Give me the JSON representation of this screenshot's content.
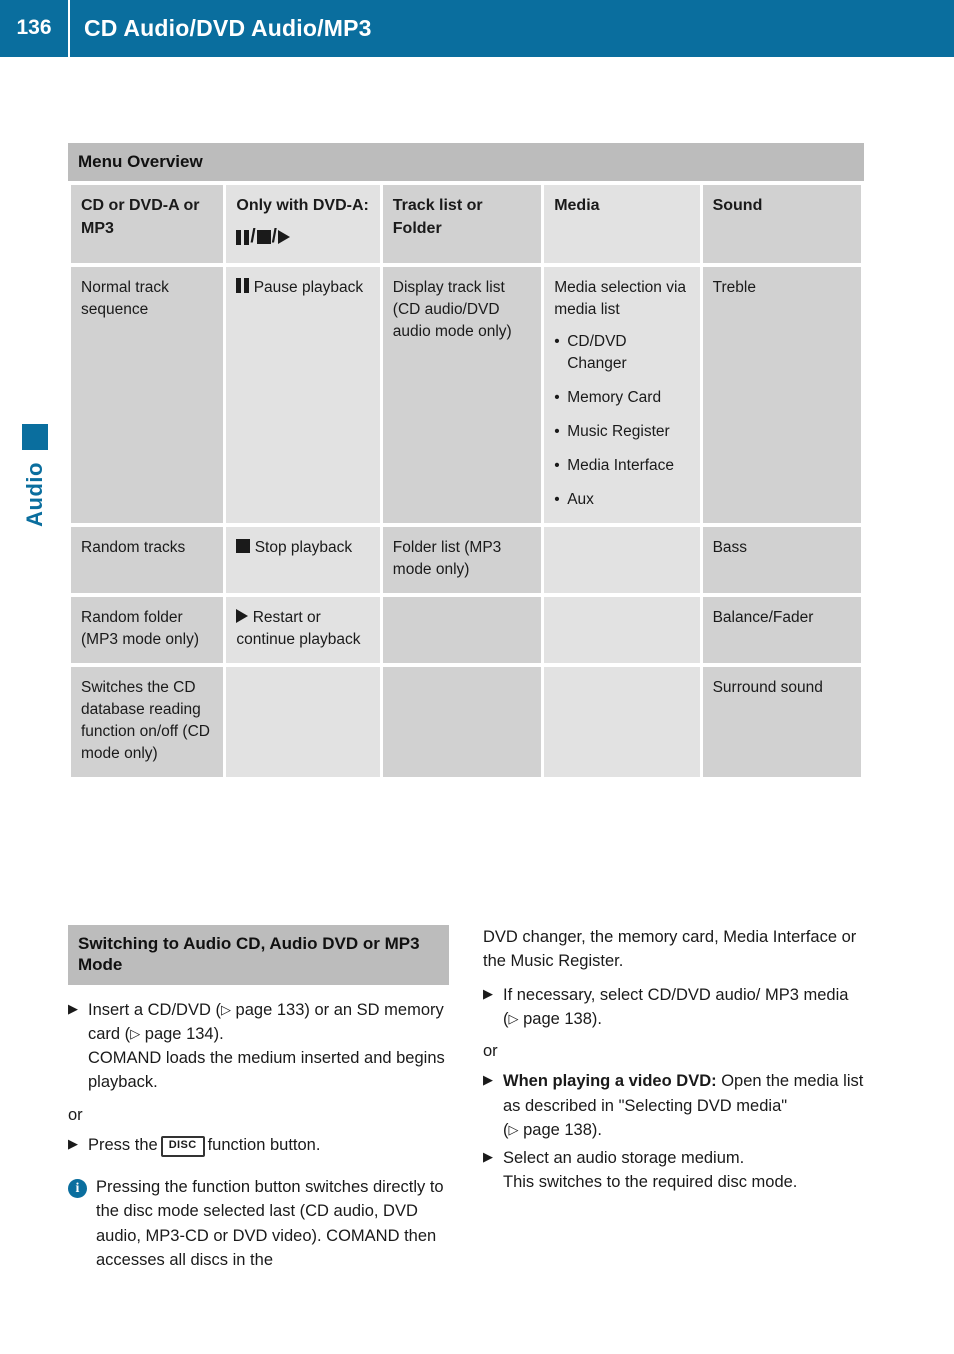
{
  "header": {
    "page_number": "136",
    "title": "CD Audio/DVD Audio/MP3",
    "accent_color": "#0a6e9e"
  },
  "side_tab": {
    "label": "Audio",
    "color": "#0a6e9e"
  },
  "menu_overview": {
    "banner": "Menu Overview",
    "columns": [
      {
        "header": "CD or DVD-A or MP3",
        "shade": "dark"
      },
      {
        "header": "Only with DVD-A:",
        "glyphs": "pause/stop/play",
        "shade": "light"
      },
      {
        "header": "Track list or Folder",
        "shade": "dark"
      },
      {
        "header": "Media",
        "shade": "light"
      },
      {
        "header": "Sound",
        "shade": "dark"
      }
    ],
    "rows": [
      {
        "c1": "Normal track sequence",
        "c2_icon": "pause-icon",
        "c2": "Pause playback",
        "c3": "Display track list (CD audio/DVD audio mode only)",
        "c4": "Media selection via media list",
        "c4_bullets": [
          "CD/DVD Changer",
          "Memory Card",
          "Music Register",
          "Media Interface",
          "Aux"
        ],
        "c5": "Treble"
      },
      {
        "c1": "Random tracks",
        "c2_icon": "stop-icon",
        "c2": "Stop playback",
        "c3": "Folder list (MP3 mode only)",
        "c4": "",
        "c4_bullets": [],
        "c5": "Bass"
      },
      {
        "c1": "Random folder (MP3 mode only)",
        "c2_icon": "play-icon",
        "c2": "Restart or continue playback",
        "c3": "",
        "c4": "",
        "c4_bullets": [],
        "c5": "Balance/Fader"
      },
      {
        "c1": "Switches the CD database reading function on/off (CD mode only)",
        "c2_icon": "",
        "c2": "",
        "c3": "",
        "c4": "",
        "c4_bullets": [],
        "c5": "Surround sound"
      }
    ]
  },
  "switching": {
    "banner": "Switching to Audio CD, Audio DVD or MP3 Mode",
    "left": {
      "step1_a": "Insert a CD/DVD (",
      "step1_ref1": "page 133",
      "step1_b": ") or an SD memory card (",
      "step1_ref2": "page 134",
      "step1_c": ").",
      "step1_line2": "COMAND loads the medium inserted and begins playback.",
      "or": "or",
      "step2_a": "Press the",
      "step2_key": "DISC",
      "step2_b": "function button.",
      "note": "Pressing the function button switches directly to the disc mode selected last (CD audio, DVD audio, MP3-CD or DVD video). COMAND then accesses all discs in the"
    },
    "right": {
      "continued": "DVD changer, the memory card, Media Interface or the Music Register.",
      "step3_a": "If necessary, select CD/DVD audio/ MP3 media (",
      "step3_ref": "page 138",
      "step3_b": ").",
      "or": "or",
      "step4_bold": "When playing a video DVD:",
      "step4_a": " Open the media list as described in \"Selecting DVD media\" (",
      "step4_ref": "page 138",
      "step4_b": ").",
      "step5_line1": "Select an audio storage medium.",
      "step5_line2": "This switches to the required disc mode."
    }
  }
}
